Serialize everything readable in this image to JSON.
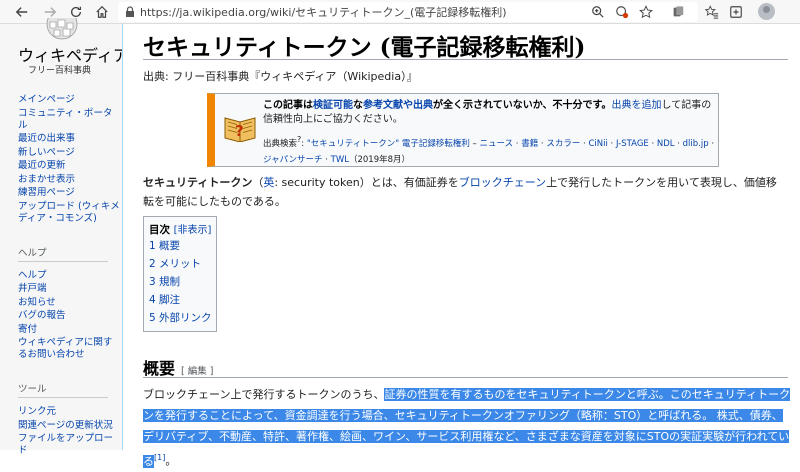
{
  "browser": {
    "url": "https://ja.wikipedia.org/wiki/セキュリティトークン_(電子記録移転権利)"
  },
  "sidebar": {
    "logo_title": "ウィキペディア",
    "logo_subtitle": "フリー百科事典",
    "nav_links": [
      "メインページ",
      "コミュニティ・ポータル",
      "最近の出来事",
      "新しいページ",
      "最近の更新",
      "おまかせ表示",
      "練習用ページ",
      "アップロード (ウィキメディア・コモンズ)"
    ],
    "help_heading": "ヘルプ",
    "help_links": [
      "ヘルプ",
      "井戸端",
      "お知らせ",
      "バグの報告",
      "寄付",
      "ウィキペディアに関するお問い合わせ"
    ],
    "tools_heading": "ツール",
    "tools_links": [
      "リンク元",
      "関連ページの更新状況",
      "ファイルをアップロード"
    ]
  },
  "article": {
    "title": "セキュリティトークン (電子記録移転権利)",
    "source": "出典: フリー百科事典『ウィキペディア（Wikipedia）』",
    "ambox": {
      "p1": "この記事は",
      "l1": "検証可能",
      "p2": "な",
      "l2": "参考文献や出典",
      "p3": "が全く示されていないか、不十分です。",
      "l3": "出典を追加",
      "p4": "して記事の信頼性向上にご協力ください。",
      "search_label": "出典検索",
      "search_sup": "?",
      "search_colon": ": ",
      "search_query": "\"セキュリティトークン\" 電子記録移転権利",
      "search_sep": " – ",
      "search_targets": [
        "ニュース",
        "書籍",
        "スカラー",
        "CiNii",
        "J-STAGE",
        "NDL",
        "dlib.jp",
        "ジャパンサーチ",
        "TWL"
      ],
      "date": "（2019年8月）"
    },
    "lead": {
      "term": "セキュリティトークン",
      "lang_prefix": "（",
      "lang": "英",
      "lang_text": ": security token）とは、有価証券を",
      "blockchain": "ブロックチェーン",
      "rest": "上で発行したトークンを用いて表現し、価値移転を可能にしたものである。"
    },
    "toc": {
      "title": "目次",
      "toggle": "[非表示]",
      "items": [
        "1 概要",
        "2 メリット",
        "3 規制",
        "4 脚注",
        "5 外部リンク"
      ]
    },
    "section": {
      "heading": "概要",
      "edit": "[ 編集 ]",
      "text_plain": "ブロックチェーン上で発行するトークンのうち、",
      "text_highlighted": "証券の性質を有するものをセキュリティトークンと呼ぶ。このセキュリティトークンを発行することによって、資金調達を行う場合、セキュリティトークンオファリング（略称：STO）と呼ばれる。 株式、債券、デリバティブ、不動産、特許、著作権、絵画、ワイン、サービス利用権など、さまざまな資産を対象にSTOの実証実験が行われている",
      "footnote": "[1]",
      "end": "。"
    }
  }
}
